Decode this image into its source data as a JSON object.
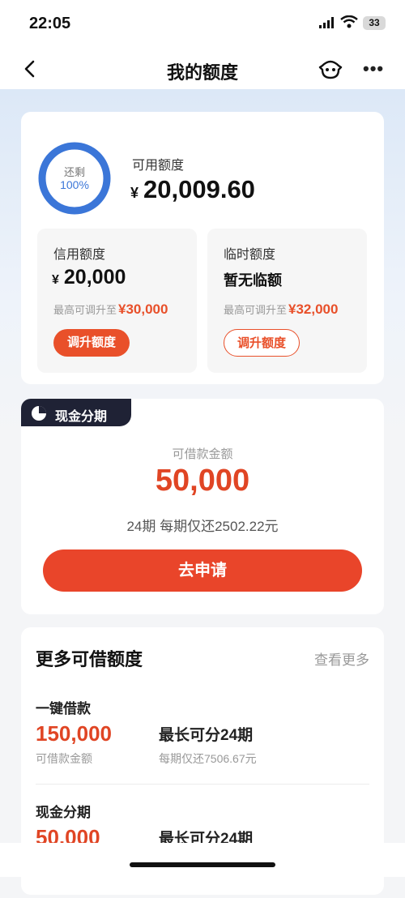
{
  "status_bar": {
    "time": "22:05",
    "battery": "33"
  },
  "nav": {
    "title": "我的额度"
  },
  "quota": {
    "ring_label": "还剩",
    "ring_percent": "100%",
    "ring_fraction": 1.0,
    "available_label": "可用额度",
    "currency": "¥",
    "available_value": "20,009.60",
    "credit": {
      "label": "信用额度",
      "value": "20,000",
      "note_prefix": "最高可调升至",
      "note_value": "¥30,000",
      "button": "调升额度"
    },
    "temp": {
      "label": "临时额度",
      "value_text": "暂无临额",
      "note_prefix": "最高可调升至",
      "note_value": "¥32,000",
      "button": "调升额度"
    }
  },
  "cash_installment": {
    "tag": "现金分期",
    "amount_label": "可借款金额",
    "amount": "50,000",
    "terms": "24期  每期仅还2502.22元",
    "apply_button": "去申请"
  },
  "more": {
    "title": "更多可借额度",
    "see_more": "查看更多",
    "products": [
      {
        "name": "一键借款",
        "amount": "150,000",
        "amount_label": "可借款金额",
        "term": "最长可分24期",
        "note": "每期仅还7506.67元"
      },
      {
        "name": "现金分期",
        "amount": "50,000",
        "amount_label": "",
        "term": "最长可分24期",
        "note": ""
      }
    ]
  },
  "colors": {
    "accent": "#e9502a",
    "ring": "#3b76d8",
    "tag_bg": "#1f2235"
  }
}
